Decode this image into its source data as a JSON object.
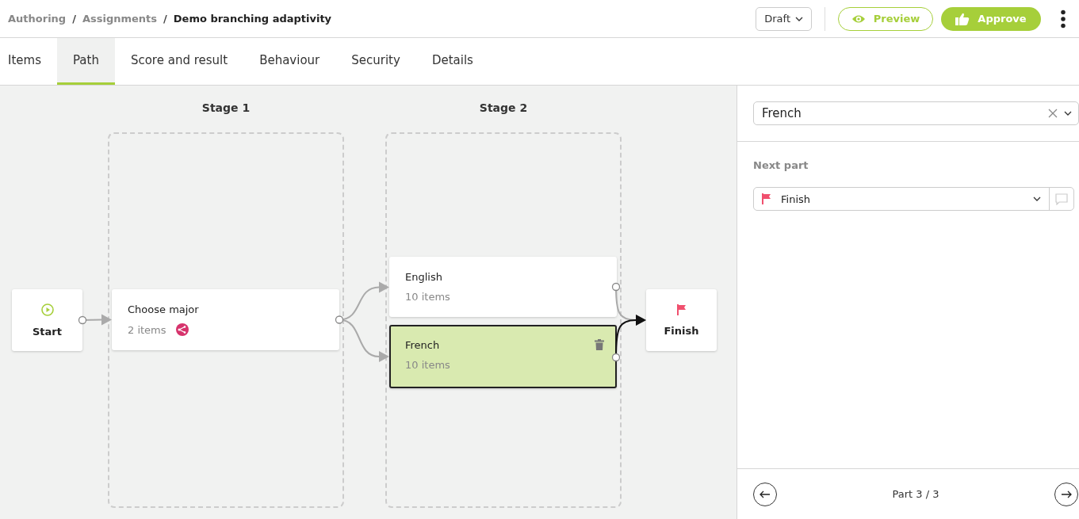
{
  "breadcrumb": [
    {
      "kind": "link",
      "label": "Authoring",
      "current": false
    },
    {
      "kind": "separator",
      "label": "/"
    },
    {
      "kind": "link",
      "label": "Assignments",
      "current": false
    },
    {
      "kind": "separator",
      "label": "/"
    },
    {
      "kind": "link",
      "label": "Demo branching adaptivity",
      "current": true
    }
  ],
  "status_dropdown": {
    "value": "Draft"
  },
  "actions": [
    {
      "label": "Preview",
      "kind": "outline"
    },
    {
      "label": "Approve",
      "kind": "primary"
    }
  ],
  "tabs": [
    {
      "label": "Items",
      "selected": false
    },
    {
      "label": "Path",
      "selected": true
    },
    {
      "label": "Score and result",
      "selected": false
    },
    {
      "label": "Behaviour",
      "selected": false
    },
    {
      "label": "Security",
      "selected": false
    },
    {
      "label": "Details",
      "selected": false
    }
  ],
  "path": {
    "start": {
      "label": "Start"
    },
    "finish": {
      "label": "Finish"
    },
    "stages": [
      {
        "title": "Stage 1",
        "parts": [
          {
            "name": "Choose major",
            "count": "2 items",
            "branching": true,
            "selected": false
          }
        ]
      },
      {
        "title": "Stage 2",
        "parts": [
          {
            "name": "English",
            "count": "10 items",
            "branching": false,
            "selected": false
          },
          {
            "name": "French",
            "count": "10 items",
            "branching": false,
            "selected": true
          }
        ]
      }
    ]
  },
  "side_panel": {
    "part_select": {
      "value": "French"
    },
    "next_part": {
      "label": "Next part",
      "value": "Finish"
    },
    "pager": {
      "label": "Part 3 / 3"
    }
  }
}
